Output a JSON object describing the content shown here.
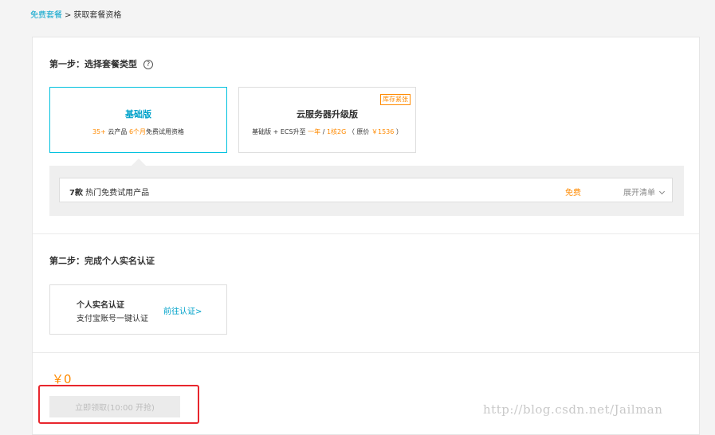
{
  "breadcrumb": {
    "root": "免费套餐",
    "separator": ">",
    "current": "获取套餐资格"
  },
  "step1": {
    "title": "第一步：选择套餐类型",
    "help_icon": "?"
  },
  "plans": {
    "basic": {
      "name": "基础版",
      "desc_count": "35+",
      "desc_text1": "云产品",
      "desc_duration": "6个月",
      "desc_text2": "免费试用资格"
    },
    "upgrade": {
      "name": "云服务器升级版",
      "badge": "库存紧张",
      "desc_prefix": "基础版 + ECS升至",
      "desc_year": "一年",
      "desc_slash": "/",
      "desc_spec": "1核2G",
      "desc_orig_open": "（ 原价",
      "desc_price": "￥1536",
      "desc_orig_close": "）"
    }
  },
  "products": {
    "count": "7款",
    "label": "热门免费试用产品",
    "free": "免费",
    "expand": "展开清单"
  },
  "step2": {
    "title": "第二步：完成个人实名认证"
  },
  "verify": {
    "title": "个人实名认证",
    "subtitle": "支付宝账号一键认证",
    "link": "前往认证>"
  },
  "price": "￥0",
  "claim_button": "立即领取(10:00 开抢)",
  "watermark": "http://blog.csdn.net/Jailman",
  "colors": {
    "accent": "#00c1de",
    "orange": "#ff8a00",
    "highlight": "#e8262d"
  }
}
